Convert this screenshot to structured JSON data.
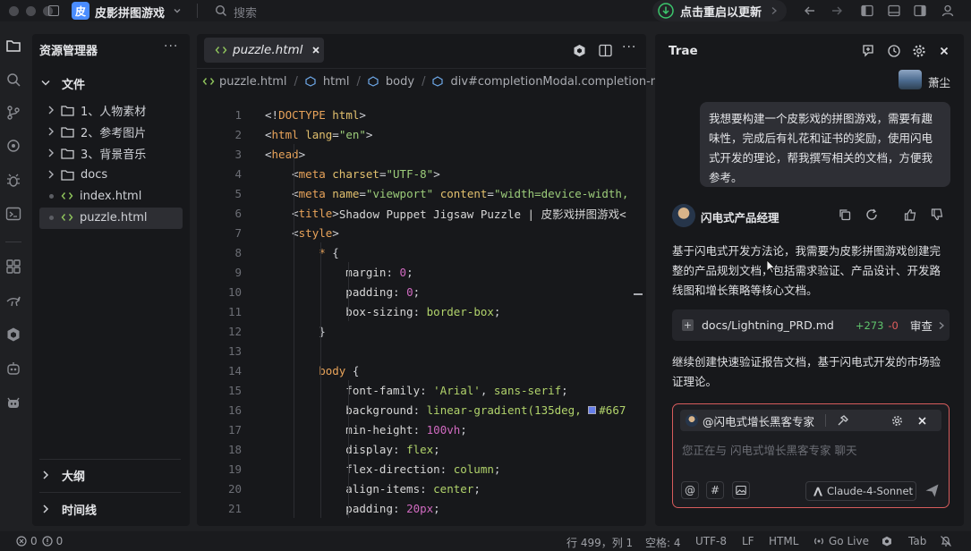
{
  "app": {
    "icon_char": "皮",
    "project_name": "皮影拼图游戏",
    "search_placeholder": "搜索",
    "update_label": "点击重启以更新"
  },
  "explorer": {
    "title": "资源管理器",
    "section": "文件",
    "items": [
      {
        "label": "1、人物素材",
        "type": "folder"
      },
      {
        "label": "2、参考图片",
        "type": "folder"
      },
      {
        "label": "3、背景音乐",
        "type": "folder"
      },
      {
        "label": "docs",
        "type": "folder"
      },
      {
        "label": "index.html",
        "type": "file"
      },
      {
        "label": "puzzle.html",
        "type": "file"
      }
    ],
    "outline": "大纲",
    "timeline": "时间线"
  },
  "editor": {
    "tab": "puzzle.html",
    "breadcrumb": [
      "puzzle.html",
      "html",
      "body",
      "div#completionModal.completion-moda"
    ],
    "lines": [
      [
        [
          "t-punc",
          "<!"
        ],
        [
          "t-tag",
          "DOCTYPE"
        ],
        [
          "t-attr",
          " html"
        ],
        [
          "t-punc",
          ">"
        ]
      ],
      [
        [
          "t-punc",
          "<"
        ],
        [
          "t-tag",
          "html"
        ],
        [
          "t-attr",
          " lang"
        ],
        [
          "t-punc",
          "="
        ],
        [
          "t-str",
          "\"en\""
        ],
        [
          "t-punc",
          ">"
        ]
      ],
      [
        [
          "t-punc",
          "<"
        ],
        [
          "t-tag",
          "head"
        ],
        [
          "t-punc",
          ">"
        ]
      ],
      [
        [
          "t-punc",
          "    <"
        ],
        [
          "t-tag",
          "meta"
        ],
        [
          "t-attr",
          " charset"
        ],
        [
          "t-punc",
          "="
        ],
        [
          "t-str",
          "\"UTF-8\""
        ],
        [
          "t-punc",
          ">"
        ]
      ],
      [
        [
          "t-punc",
          "    <"
        ],
        [
          "t-tag",
          "meta"
        ],
        [
          "t-attr",
          " name"
        ],
        [
          "t-punc",
          "="
        ],
        [
          "t-str",
          "\"viewport\""
        ],
        [
          "t-attr",
          " content"
        ],
        [
          "t-punc",
          "="
        ],
        [
          "t-str",
          "\"width=device-width,"
        ]
      ],
      [
        [
          "t-punc",
          "    <"
        ],
        [
          "t-tag",
          "title"
        ],
        [
          "t-punc",
          ">"
        ],
        [
          "t-txt",
          "Shadow Puppet Jigsaw Puzzle | 皮影戏拼图游戏<"
        ]
      ],
      [
        [
          "t-punc",
          "    <"
        ],
        [
          "t-tag",
          "style"
        ],
        [
          "t-punc",
          ">"
        ]
      ],
      [
        [
          "t-sel",
          "        * "
        ],
        [
          "t-punc",
          "{"
        ]
      ],
      [
        [
          "t-prop",
          "            margin"
        ],
        [
          "t-punc",
          ": "
        ],
        [
          "t-val",
          "0"
        ],
        [
          "t-punc",
          ";"
        ]
      ],
      [
        [
          "t-prop",
          "            padding"
        ],
        [
          "t-punc",
          ": "
        ],
        [
          "t-val",
          "0"
        ],
        [
          "t-punc",
          ";"
        ]
      ],
      [
        [
          "t-prop",
          "            box-sizing"
        ],
        [
          "t-punc",
          ": "
        ],
        [
          "t-str2",
          "border-box"
        ],
        [
          "t-punc",
          ";"
        ]
      ],
      [
        [
          "t-punc",
          "        }"
        ]
      ],
      [
        [
          "t-punc",
          ""
        ]
      ],
      [
        [
          "t-sel",
          "        body "
        ],
        [
          "t-punc",
          "{"
        ]
      ],
      [
        [
          "t-prop",
          "            font-family"
        ],
        [
          "t-punc",
          ": "
        ],
        [
          "t-str2",
          "'Arial'"
        ],
        [
          "t-punc",
          ", "
        ],
        [
          "t-str2",
          "sans-serif"
        ],
        [
          "t-punc",
          ";"
        ]
      ],
      [
        [
          "t-prop",
          "            background"
        ],
        [
          "t-punc",
          ": "
        ],
        [
          "t-str2",
          "linear-gradient(135deg, "
        ],
        [
          "swatch",
          "#667"
        ]
      ],
      [
        [
          "t-prop",
          "            min-height"
        ],
        [
          "t-punc",
          ": "
        ],
        [
          "t-val",
          "100vh"
        ],
        [
          "t-punc",
          ";"
        ]
      ],
      [
        [
          "t-prop",
          "            display"
        ],
        [
          "t-punc",
          ": "
        ],
        [
          "t-str2",
          "flex"
        ],
        [
          "t-punc",
          ";"
        ]
      ],
      [
        [
          "t-prop",
          "            flex-direction"
        ],
        [
          "t-punc",
          ": "
        ],
        [
          "t-str2",
          "column"
        ],
        [
          "t-punc",
          ";"
        ]
      ],
      [
        [
          "t-prop",
          "            align-items"
        ],
        [
          "t-punc",
          ": "
        ],
        [
          "t-str2",
          "center"
        ],
        [
          "t-punc",
          ";"
        ]
      ],
      [
        [
          "t-prop",
          "            padding"
        ],
        [
          "t-punc",
          ": "
        ],
        [
          "t-val",
          "20px"
        ],
        [
          "t-punc",
          ";"
        ]
      ]
    ]
  },
  "chat": {
    "title": "Trae",
    "username": "萧尘",
    "user_message": "我想要构建一个皮影戏的拼图游戏，需要有趣味性，完成后有礼花和证书的奖励，使用闪电式开发的理论，帮我撰写相关的文档，方便我参考。",
    "agent_name": "闪电式产品经理",
    "agent_message": "基于闪电式开发方法论，我需要为皮影拼图游戏创建完整的产品规划文档，包括需求验证、产品设计、开发路线图和增长策略等核心文档。",
    "file_path": "docs/Lightning_PRD.md",
    "additions": "+273",
    "deletions": "-0",
    "review_label": "审查",
    "followup_message": "继续创建快速验证报告文档，基于闪电式开发的市场验证理论。",
    "input_agent": "@闪电式增长黑客专家",
    "input_placeholder": "您正在与 闪电式增长黑客专家 聊天",
    "model": "Claude-4-Sonnet"
  },
  "status": {
    "errors": "0",
    "warnings": "0",
    "position": "行 499，列 1",
    "spaces": "空格: 4",
    "encoding": "UTF-8",
    "eol": "LF",
    "language": "HTML",
    "golive": "Go Live",
    "tab": "Tab"
  },
  "colors": {
    "accent": "#4a8cff",
    "update_green": "#3cc76d",
    "additions": "#5fc36c",
    "deletions": "#e05d5d",
    "input_border": "#d75c5c"
  }
}
